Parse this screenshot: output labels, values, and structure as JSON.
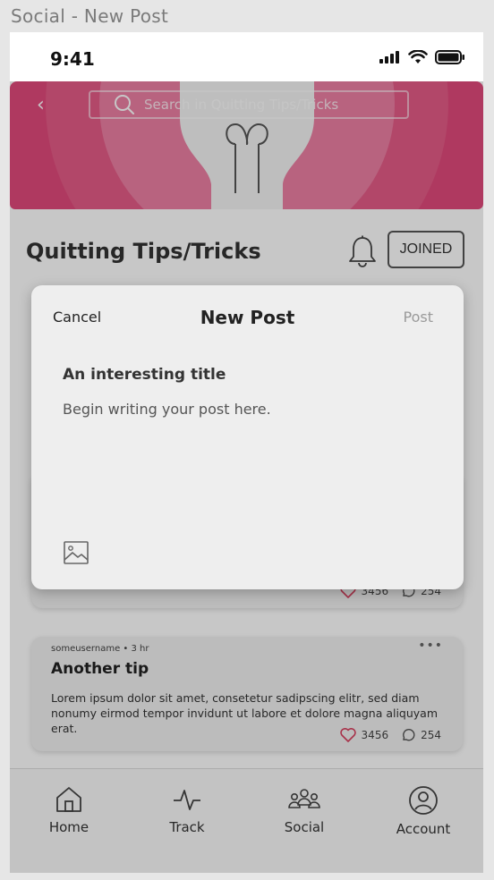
{
  "window": {
    "title": "Social - New Post"
  },
  "status_bar": {
    "time": "9:41"
  },
  "header": {
    "search_placeholder": "Search in Quitting Tips/Tricks",
    "community_title": "Quitting Tips/Tricks",
    "joined_label": "JOINED"
  },
  "posts": [
    {
      "likes": "3456",
      "comments": "254"
    },
    {
      "meta": "someusername  •  3 hr",
      "title": "Another tip",
      "body": "Lorem ipsum dolor sit amet, consetetur sadipscing elitr, sed diam nonumy eirmod tempor invidunt ut labore et dolore magna aliquyam erat.",
      "likes": "3456",
      "comments": "254"
    }
  ],
  "nav": {
    "items": [
      {
        "label": "Home",
        "icon": "home-icon"
      },
      {
        "label": "Track",
        "icon": "pulse-icon"
      },
      {
        "label": "Social",
        "icon": "group-icon"
      },
      {
        "label": "Account",
        "icon": "user-icon"
      }
    ]
  },
  "modal": {
    "cancel_label": "Cancel",
    "title": "New Post",
    "post_label": "Post",
    "title_placeholder": "An interesting title",
    "body_placeholder": "Begin writing your post here.",
    "attach_icon": "image-icon"
  },
  "colors": {
    "banner": "#e0497b",
    "heart": "#d8415f",
    "scrim": "rgba(0,0,0,0.22)"
  }
}
